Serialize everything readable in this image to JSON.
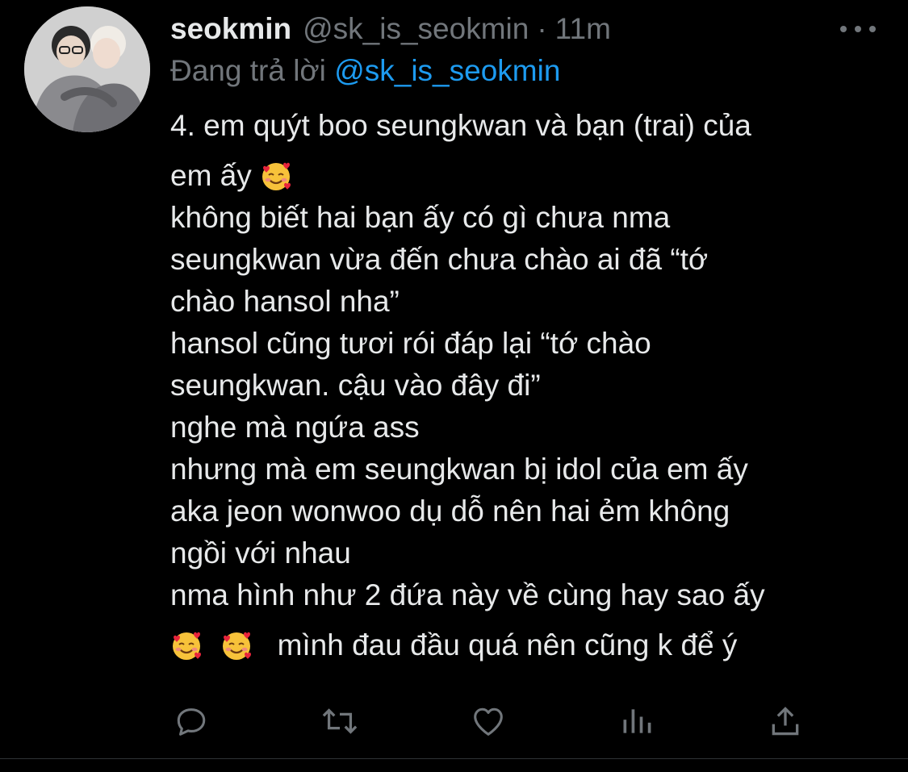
{
  "colors": {
    "background": "#000000",
    "text": "#e7e9ea",
    "secondary": "#71767b",
    "link": "#1d9bf0",
    "divider": "#2f3336"
  },
  "tweet": {
    "author_name": "seokmin",
    "author_handle": "@sk_is_seokmin",
    "separator": "·",
    "time": "11m",
    "reply_prefix": "Đang trả lời",
    "reply_to_handle": "@sk_is_seokmin",
    "lines": [
      "4. em quýt boo seungkwan và bạn (trai) của",
      "em ấy",
      "không biết hai bạn ấy có gì chưa nma",
      "seungkwan vừa đến chưa chào ai đã “tớ",
      "chào hansol nha”",
      "hansol cũng tươi rói đáp lại “tớ chào",
      "seungkwan. cậu vào đây đi”",
      "nghe mà ngứa ass",
      "nhưng mà em seungkwan bị idol của em ấy",
      "aka jeon wonwoo dụ dỗ nên hai ẻm không",
      "ngồi với nhau",
      "nma hình như 2 đứa này về cùng hay sao ấy",
      "mình đau đầu quá nên cũng k để ý"
    ],
    "emoji": "smiling-face-with-hearts"
  },
  "actions": [
    {
      "name": "reply-button",
      "icon": "reply-icon"
    },
    {
      "name": "retweet-button",
      "icon": "retweet-icon"
    },
    {
      "name": "like-button",
      "icon": "heart-icon"
    },
    {
      "name": "analytics-button",
      "icon": "analytics-icon"
    },
    {
      "name": "share-button",
      "icon": "share-icon"
    }
  ]
}
